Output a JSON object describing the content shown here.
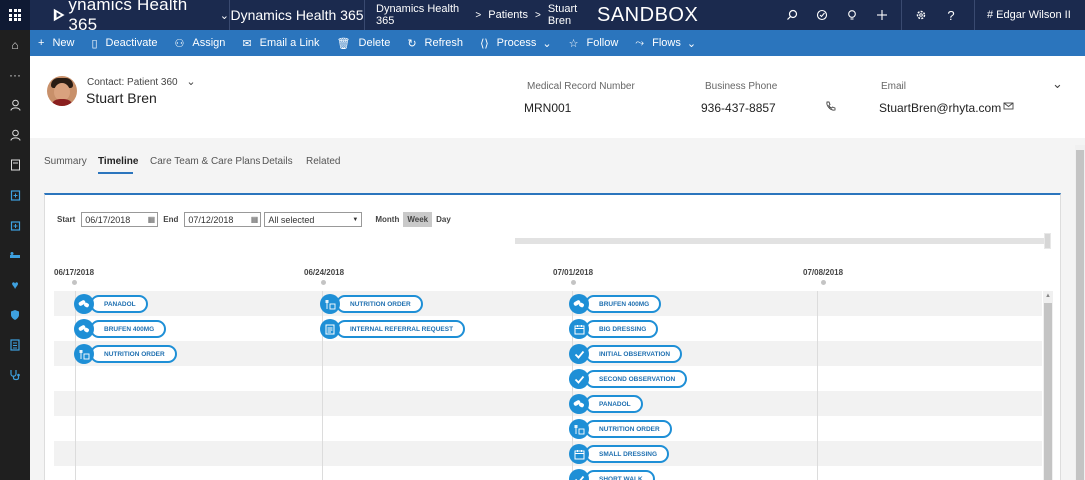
{
  "topbar": {
    "brand": "ynamics Health 365",
    "app_name": "Dynamics Health 365",
    "breadcrumb": [
      "Dynamics Health 365",
      "Patients",
      "Stuart Bren"
    ],
    "environment": "SANDBOX",
    "user": "# Edgar Wilson II",
    "icons": [
      "search-icon",
      "task-icon",
      "lightbulb-icon",
      "plus-icon",
      "gear-icon",
      "help-icon"
    ]
  },
  "rail": {
    "icons": [
      "home-icon",
      "more-icon",
      "contact-icon",
      "patient-icon",
      "document-icon",
      "clipboard-icon",
      "hospital-icon",
      "bed-icon",
      "heart-icon",
      "shield-icon",
      "notes-icon",
      "stethoscope-icon"
    ]
  },
  "commands": [
    {
      "label": "New",
      "icon": "+"
    },
    {
      "label": "Deactivate",
      "icon": "▯"
    },
    {
      "label": "Assign",
      "icon": "⚇"
    },
    {
      "label": "Email a Link",
      "icon": "✉"
    },
    {
      "label": "Delete",
      "icon": "🗑"
    },
    {
      "label": "Refresh",
      "icon": "↻"
    },
    {
      "label": "Process",
      "icon": "⟨⟩",
      "dropdown": "⌄"
    },
    {
      "label": "Follow",
      "icon": "☆"
    },
    {
      "label": "Flows",
      "icon": "⤳",
      "dropdown": "⌄"
    }
  ],
  "header": {
    "form_name": "Contact: Patient 360",
    "record_name": "Stuart Bren",
    "fields": [
      {
        "label": "Medical Record Number",
        "value": "MRN001"
      },
      {
        "label": "Business Phone",
        "value": "936-437-8857"
      },
      {
        "label": "Email",
        "value": "StuartBren@rhyta.com"
      }
    ]
  },
  "tabs": [
    "Summary",
    "Timeline",
    "Care Team & Care Plans",
    "Details",
    "Related"
  ],
  "active_tab": "Timeline",
  "timeline": {
    "start_label": "Start",
    "start_date": "06/17/2018",
    "end_label": "End",
    "end_date": "07/12/2018",
    "filter": "All selected",
    "views": [
      "Month",
      "Week",
      "Day"
    ],
    "active_view": "Week",
    "week_labels": [
      "06/17/2018",
      "06/24/2018",
      "07/01/2018",
      "07/08/2018"
    ],
    "columns": [
      {
        "events": [
          {
            "label": "PANADOL",
            "icon": "pill"
          },
          {
            "label": "BRUFEN 400MG",
            "icon": "pill"
          },
          {
            "label": "NUTRITION ORDER",
            "icon": "food"
          }
        ]
      },
      {
        "events": [
          {
            "label": "NUTRITION ORDER",
            "icon": "food"
          },
          {
            "label": "INTERNAL REFERRAL REQUEST",
            "icon": "doc"
          }
        ]
      },
      {
        "events": [
          {
            "label": "BRUFEN 400MG",
            "icon": "pill"
          },
          {
            "label": "BIG DRESSING",
            "icon": "cal"
          },
          {
            "label": "INITIAL OBSERVATION",
            "icon": "check"
          },
          {
            "label": "SECOND OBSERVATION",
            "icon": "check"
          },
          {
            "label": "PANADOL",
            "icon": "pill"
          },
          {
            "label": "NUTRITION ORDER",
            "icon": "food"
          },
          {
            "label": "SMALL DRESSING",
            "icon": "cal"
          },
          {
            "label": "SHORT WALK",
            "icon": "check"
          }
        ]
      },
      {
        "events": []
      }
    ]
  },
  "colors": {
    "topbar": "#1b2a4e",
    "command_bar": "#2b75bd",
    "accent": "#1e8fd6"
  }
}
